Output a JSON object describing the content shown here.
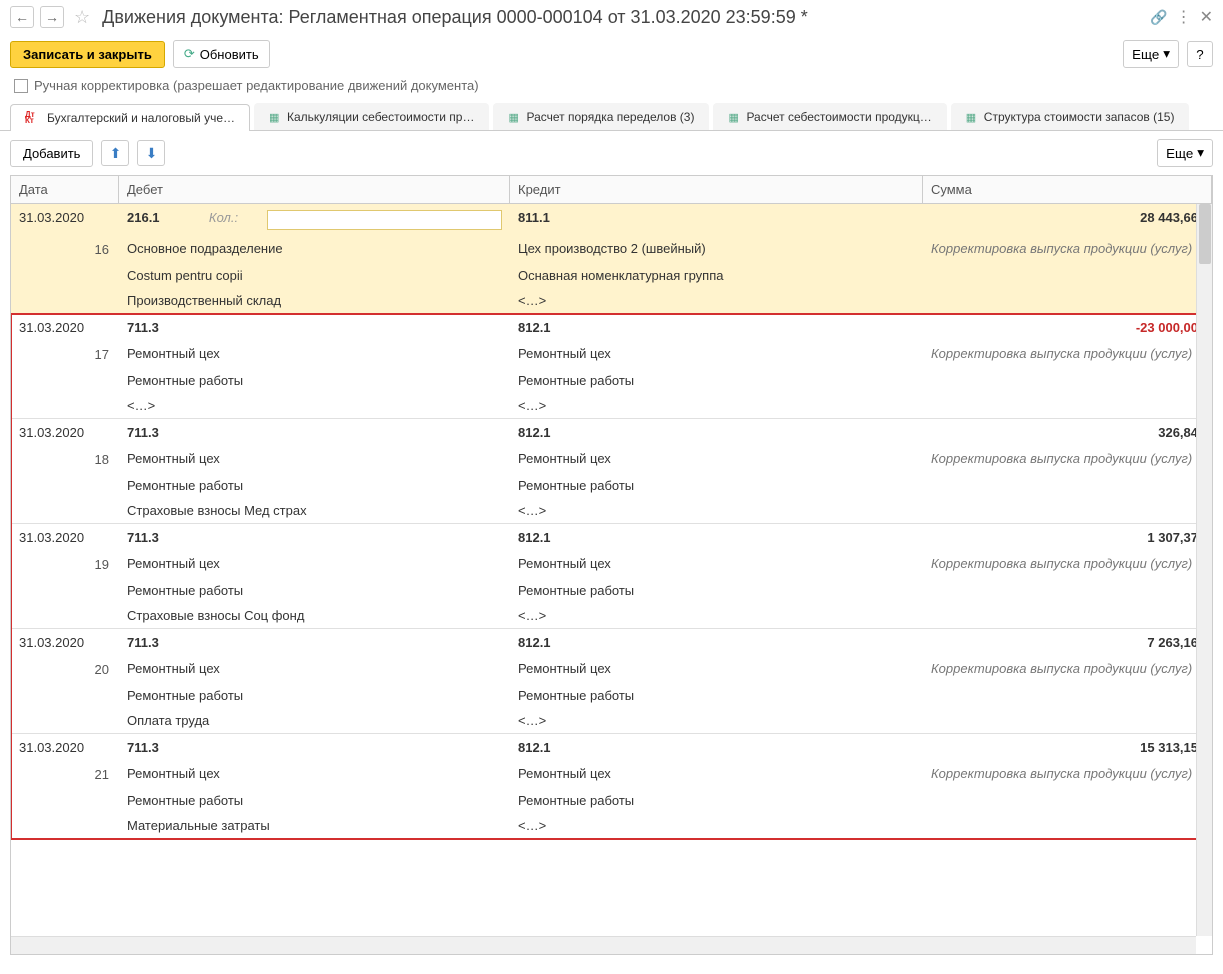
{
  "title": "Движения документа: Регламентная операция 0000-000104 от 31.03.2020 23:59:59 *",
  "toolbar": {
    "save_close": "Записать и закрыть",
    "refresh": "Обновить",
    "more": "Еще",
    "help": "?"
  },
  "checkbox_label": "Ручная корректировка (разрешает редактирование движений документа)",
  "tabs": [
    {
      "label": "Бухгалтерский и налоговый уче…"
    },
    {
      "label": "Калькуляции себестоимости пр…"
    },
    {
      "label": "Расчет порядка переделов (3)"
    },
    {
      "label": "Расчет себестоимости продукц…"
    },
    {
      "label": "Структура стоимости запасов (15)"
    }
  ],
  "subtoolbar": {
    "add": "Добавить",
    "more": "Еще"
  },
  "columns": {
    "date": "Дата",
    "debit": "Дебет",
    "credit": "Кредит",
    "sum": "Сумма"
  },
  "qty_label": "Кол.:",
  "rows": [
    {
      "date": "31.03.2020",
      "idx": "16",
      "debit_acc": "216.1",
      "credit_acc": "811.1",
      "sum": "28 443,66",
      "highlighted": true,
      "has_qty": true,
      "debit_subs": [
        "Основное подразделение",
        "Costum pentru copii",
        "Производственный склад"
      ],
      "credit_subs": [
        "Цех производство 2 (швейный)",
        "Оснавная номенклатурная группа",
        "<…>"
      ],
      "note": "Корректировка выпуска продукции (услуг)"
    },
    {
      "date": "31.03.2020",
      "idx": "17",
      "debit_acc": "711.3",
      "credit_acc": "812.1",
      "sum": "-23 000,00",
      "negative": true,
      "debit_subs": [
        "Ремонтный цех",
        "Ремонтные работы",
        "<…>"
      ],
      "credit_subs": [
        "Ремонтный цех",
        "Ремонтные работы",
        "<…>"
      ],
      "note": "Корректировка выпуска продукции (услуг)"
    },
    {
      "date": "31.03.2020",
      "idx": "18",
      "debit_acc": "711.3",
      "credit_acc": "812.1",
      "sum": "326,84",
      "debit_subs": [
        "Ремонтный цех",
        "Ремонтные работы",
        "Страховые взносы Мед страх"
      ],
      "credit_subs": [
        "Ремонтный цех",
        "Ремонтные работы",
        "<…>"
      ],
      "note": "Корректировка выпуска продукции (услуг)"
    },
    {
      "date": "31.03.2020",
      "idx": "19",
      "debit_acc": "711.3",
      "credit_acc": "812.1",
      "sum": "1 307,37",
      "debit_subs": [
        "Ремонтный цех",
        "Ремонтные работы",
        "Страховые взносы Соц фонд"
      ],
      "credit_subs": [
        "Ремонтный цех",
        "Ремонтные работы",
        "<…>"
      ],
      "note": "Корректировка выпуска продукции (услуг)"
    },
    {
      "date": "31.03.2020",
      "idx": "20",
      "debit_acc": "711.3",
      "credit_acc": "812.1",
      "sum": "7 263,16",
      "debit_subs": [
        "Ремонтный цех",
        "Ремонтные работы",
        "Оплата труда"
      ],
      "credit_subs": [
        "Ремонтный цех",
        "Ремонтные работы",
        "<…>"
      ],
      "note": "Корректировка выпуска продукции (услуг)"
    },
    {
      "date": "31.03.2020",
      "idx": "21",
      "debit_acc": "711.3",
      "credit_acc": "812.1",
      "sum": "15 313,15",
      "debit_subs": [
        "Ремонтный цех",
        "Ремонтные работы",
        "Материальные затраты"
      ],
      "credit_subs": [
        "Ремонтный цех",
        "Ремонтные работы",
        "<…>"
      ],
      "note": "Корректировка выпуска продукции (услуг)"
    }
  ]
}
